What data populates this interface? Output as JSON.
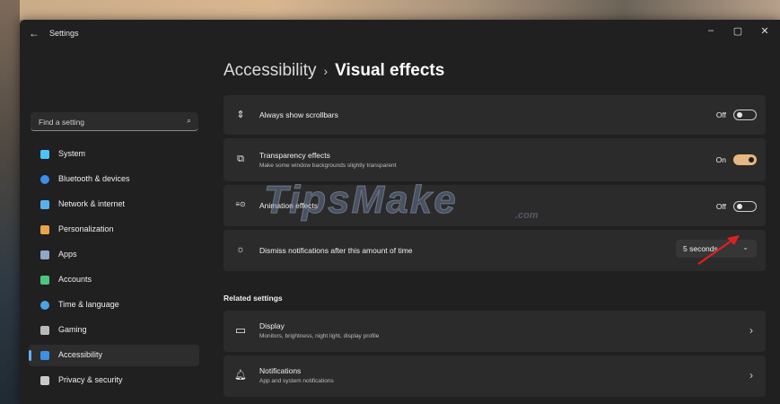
{
  "window": {
    "title": "Settings",
    "back_glyph": "←",
    "controls": {
      "minimize": "–",
      "maximize": "▢",
      "close": "✕"
    }
  },
  "search": {
    "placeholder": "Find a setting",
    "icon": "search-icon",
    "icon_glyph": "⌕"
  },
  "sidebar": {
    "items": [
      {
        "label": "System",
        "icon": "system-icon",
        "color": "#4cc2ff",
        "active": false
      },
      {
        "label": "Bluetooth & devices",
        "icon": "bluetooth-icon",
        "color": "#3b8eea",
        "active": false
      },
      {
        "label": "Network & internet",
        "icon": "network-icon",
        "color": "#5ab0ee",
        "active": false
      },
      {
        "label": "Personalization",
        "icon": "personalization-icon",
        "color": "#e9a34a",
        "active": false
      },
      {
        "label": "Apps",
        "icon": "apps-icon",
        "color": "#8fa7c9",
        "active": false
      },
      {
        "label": "Accounts",
        "icon": "accounts-icon",
        "color": "#4dc57c",
        "active": false
      },
      {
        "label": "Time & language",
        "icon": "time-language-icon",
        "color": "#49a4e8",
        "active": false
      },
      {
        "label": "Gaming",
        "icon": "gaming-icon",
        "color": "#b9b9b9",
        "active": false
      },
      {
        "label": "Accessibility",
        "icon": "accessibility-icon",
        "color": "#3f8fe6",
        "active": true
      },
      {
        "label": "Privacy & security",
        "icon": "privacy-icon",
        "color": "#c9c9c9",
        "active": false
      }
    ]
  },
  "breadcrumb": {
    "parent": "Accessibility",
    "separator": "›",
    "current": "Visual effects"
  },
  "settings": {
    "scrollbars": {
      "title": "Always show scrollbars",
      "state": "Off",
      "on": false,
      "icon_glyph": "⇕"
    },
    "transparency": {
      "title": "Transparency effects",
      "subtitle": "Make some window backgrounds slightly transparent",
      "state": "On",
      "on": true,
      "icon_glyph": "⧉"
    },
    "animation": {
      "title": "Animation effects",
      "state": "Off",
      "on": false,
      "icon_glyph": "≡⊙"
    },
    "notifications_timeout": {
      "title": "Dismiss notifications after this amount of time",
      "value": "5 seconds",
      "icon_glyph": "☼",
      "chevron": "⌄"
    }
  },
  "related": {
    "heading": "Related settings",
    "display": {
      "title": "Display",
      "subtitle": "Monitors, brightness, night light, display profile",
      "icon_glyph": "▭",
      "chevron": "›"
    },
    "notifications": {
      "title": "Notifications",
      "subtitle": "App and system notifications",
      "icon_glyph": "🔔︎",
      "chevron": "›"
    }
  },
  "watermark": {
    "text": "TipsMake",
    "suffix": ".com"
  },
  "colors": {
    "accent": "#e6b880",
    "window_bg": "#202020",
    "card_bg": "#2b2b2b",
    "arrow": "#e02020"
  }
}
